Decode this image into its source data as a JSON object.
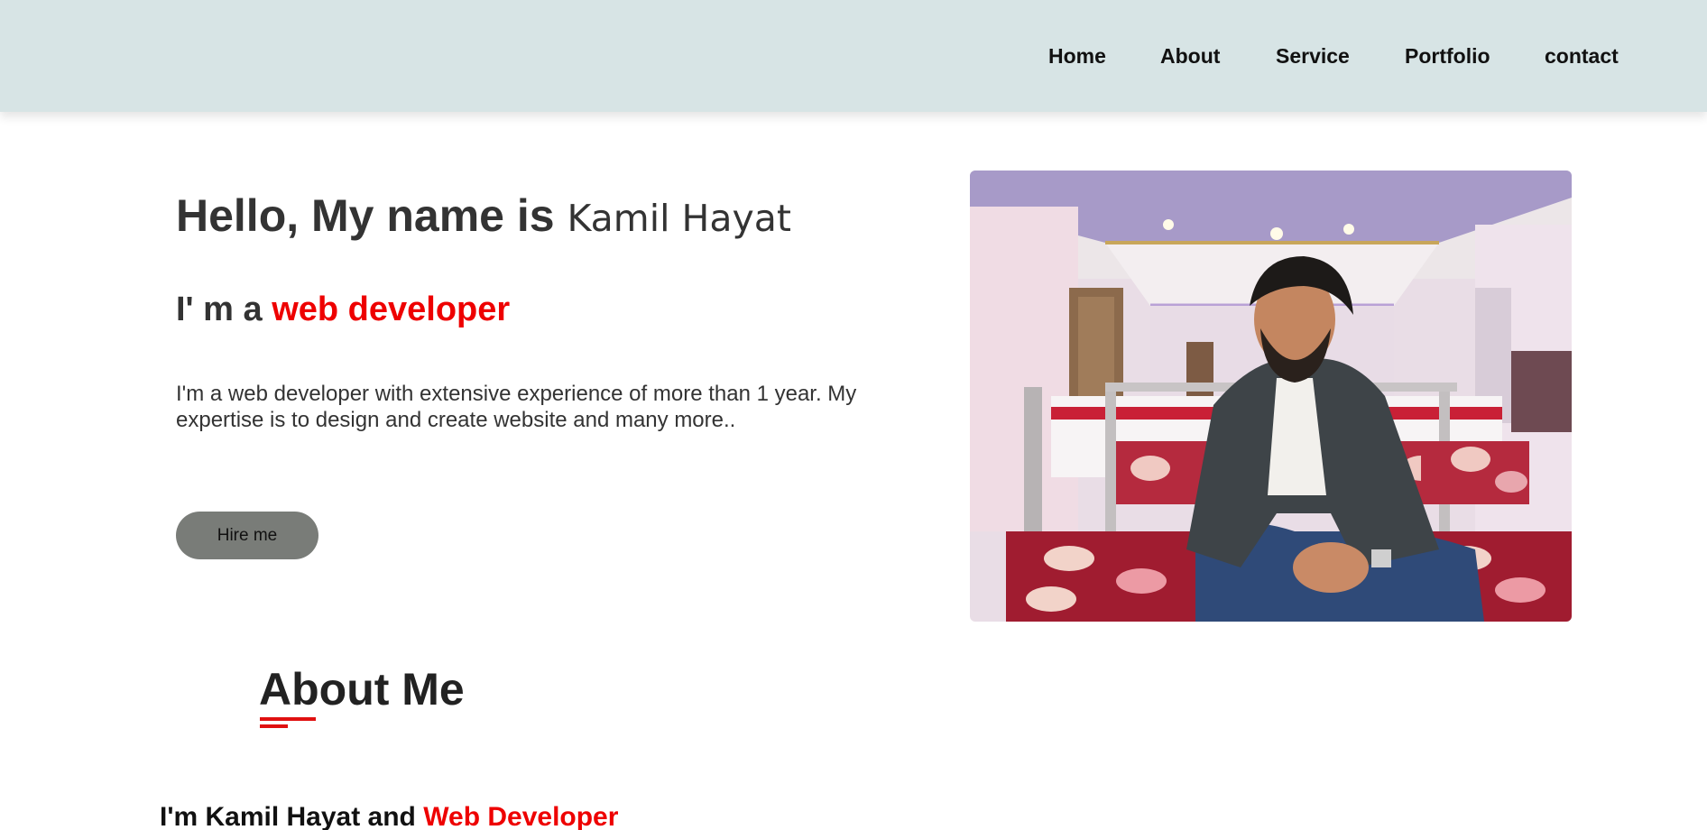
{
  "nav": {
    "items": [
      {
        "label": "Home"
      },
      {
        "label": "About"
      },
      {
        "label": "Service"
      },
      {
        "label": "Portfolio"
      },
      {
        "label": "contact"
      }
    ]
  },
  "hero": {
    "greeting": "Hello, My name is",
    "name": "Kamil Hayat",
    "role_prefix": "I' m a",
    "role_highlight": "web developer",
    "description": "I'm a web developer with extensive experience of more than 1 year. My expertise is to design and create website and many more..",
    "hire_button": "Hire me",
    "photo_icon": "portrait-photo"
  },
  "about": {
    "title": "About Me",
    "intro_prefix": "I'm Kamil Hayat and",
    "intro_highlight": "Web Developer"
  },
  "colors": {
    "header_bg": "#d7e4e5",
    "accent": "#ee0000",
    "button_bg": "#797c78",
    "text": "#333333"
  }
}
